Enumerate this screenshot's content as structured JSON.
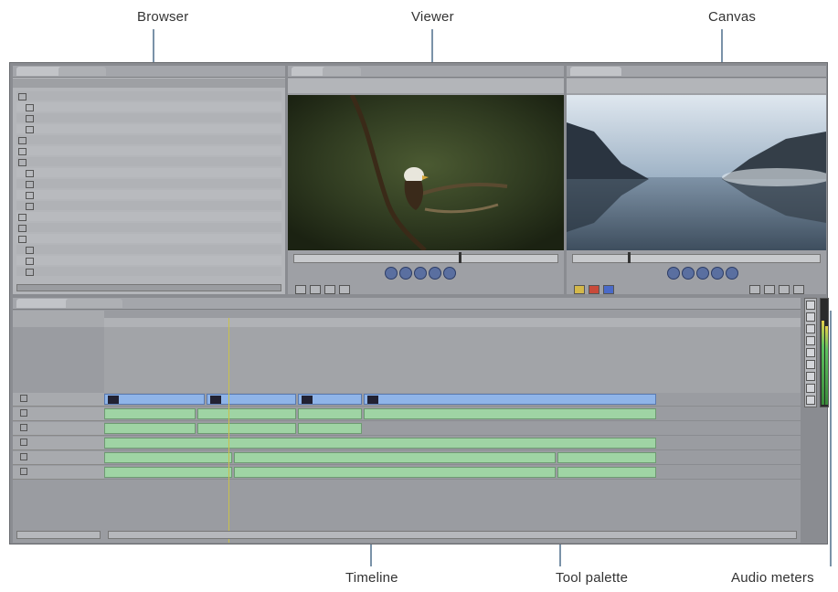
{
  "callouts": {
    "browser": "Browser",
    "viewer": "Viewer",
    "canvas": "Canvas",
    "timeline": "Timeline",
    "tool_palette": "Tool palette",
    "audio_meters": "Audio meters"
  },
  "colors": {
    "window_bg": "#8a8c91",
    "video_clip": "#8fb4e8",
    "audio_clip": "#9fd4a4",
    "leader_line": "#7a92a8"
  }
}
